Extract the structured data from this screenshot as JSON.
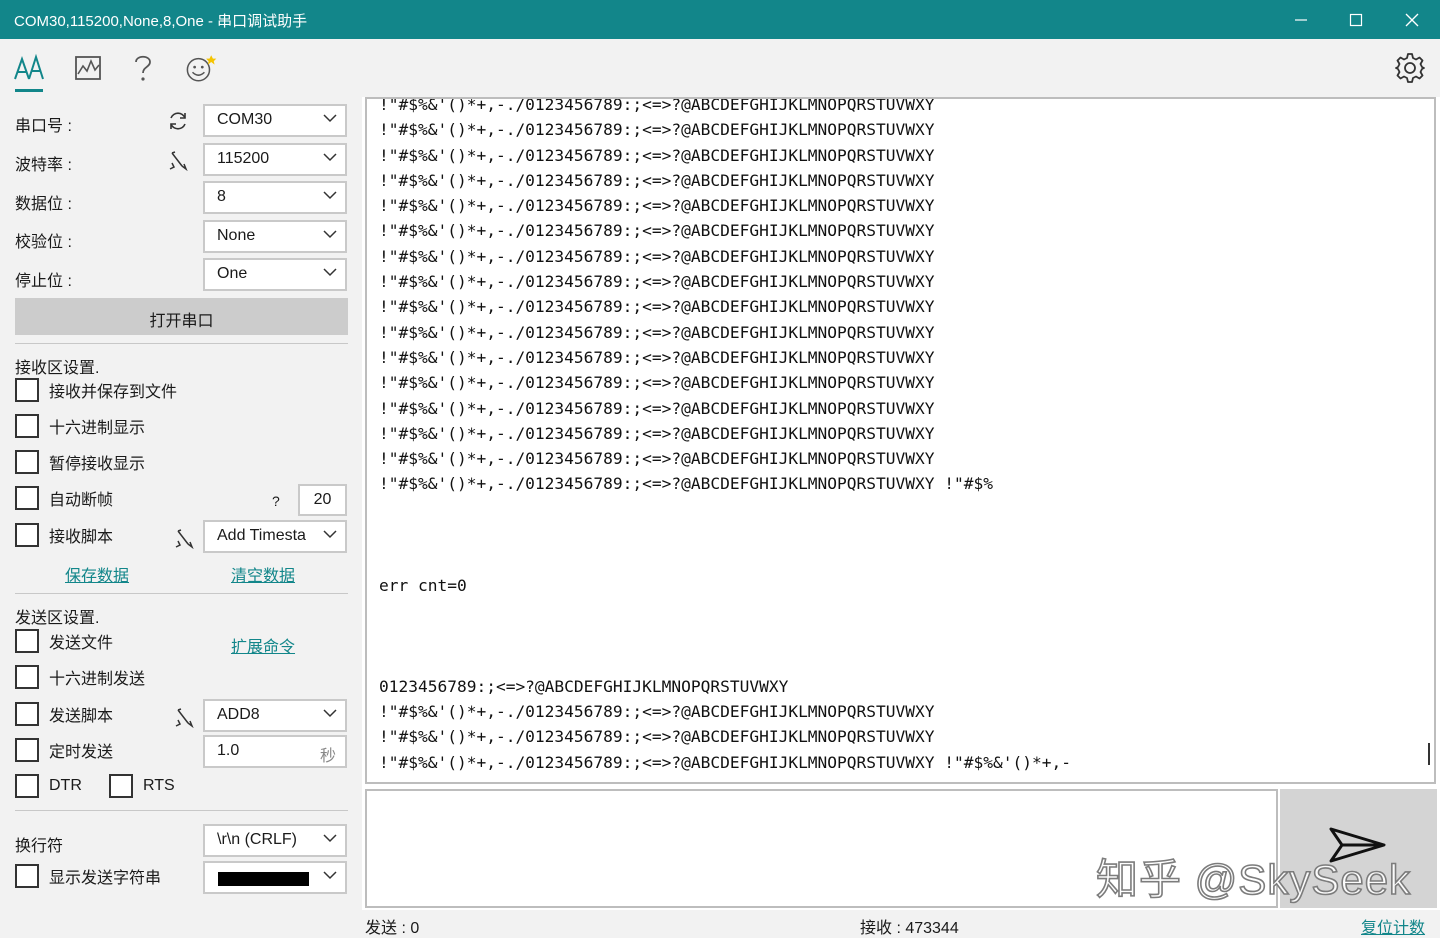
{
  "window": {
    "title": "COM30,115200,None,8,One - 串口调试助手",
    "minimize": "—",
    "maximize": "☐",
    "close": "✕"
  },
  "toolbar": {
    "icons": [
      "text-font-icon",
      "chart-icon",
      "help-icon",
      "smiley-icon"
    ],
    "settings_icon": "gear-icon",
    "accent": "#12868a"
  },
  "serial": {
    "port_label": "串口号 :",
    "port_value": "COM30",
    "baud_label": "波特率 :",
    "baud_value": "115200",
    "databits_label": "数据位 :",
    "databits_value": "8",
    "parity_label": "校验位 :",
    "parity_value": "None",
    "stopbits_label": "停止位 :",
    "stopbits_value": "One",
    "open_button": "打开串口"
  },
  "receive_settings": {
    "title": "接收区设置.",
    "save_to_file": "接收并保存到文件",
    "hex_display": "十六进制显示",
    "pause_display": "暂停接收显示",
    "auto_frame": "自动断帧",
    "auto_frame_help": "?",
    "auto_frame_value": "20",
    "script": "接收脚本",
    "script_value": "Add Timesta",
    "save_data": "保存数据",
    "clear_data": "清空数据"
  },
  "send_settings": {
    "title": "发送区设置.",
    "send_file": "发送文件",
    "extend_cmd": "扩展命令",
    "hex_send": "十六进制发送",
    "script": "发送脚本",
    "script_value": "ADD8",
    "timed_send": "定时发送",
    "timed_value": "1.0",
    "timed_unit": "秒",
    "dtr": "DTR",
    "rts": "RTS",
    "newline_label": "换行符",
    "newline_value": "\\r\\n (CRLF)",
    "show_string": "显示发送字符串"
  },
  "receive_area": {
    "lines": [
      "!\"#$%&'()*+,-./0123456789:;<=>?@ABCDEFGHIJKLMNOPQRSTUVWXY",
      "!\"#$%&'()*+,-./0123456789:;<=>?@ABCDEFGHIJKLMNOPQRSTUVWXY",
      "!\"#$%&'()*+,-./0123456789:;<=>?@ABCDEFGHIJKLMNOPQRSTUVWXY",
      "!\"#$%&'()*+,-./0123456789:;<=>?@ABCDEFGHIJKLMNOPQRSTUVWXY",
      "!\"#$%&'()*+,-./0123456789:;<=>?@ABCDEFGHIJKLMNOPQRSTUVWXY",
      "!\"#$%&'()*+,-./0123456789:;<=>?@ABCDEFGHIJKLMNOPQRSTUVWXY",
      "!\"#$%&'()*+,-./0123456789:;<=>?@ABCDEFGHIJKLMNOPQRSTUVWXY",
      "!\"#$%&'()*+,-./0123456789:;<=>?@ABCDEFGHIJKLMNOPQRSTUVWXY",
      "!\"#$%&'()*+,-./0123456789:;<=>?@ABCDEFGHIJKLMNOPQRSTUVWXY",
      "!\"#$%&'()*+,-./0123456789:;<=>?@ABCDEFGHIJKLMNOPQRSTUVWXY",
      "!\"#$%&'()*+,-./0123456789:;<=>?@ABCDEFGHIJKLMNOPQRSTUVWXY",
      "!\"#$%&'()*+,-./0123456789:;<=>?@ABCDEFGHIJKLMNOPQRSTUVWXY",
      "!\"#$%&'()*+,-./0123456789:;<=>?@ABCDEFGHIJKLMNOPQRSTUVWXY",
      "!\"#$%&'()*+,-./0123456789:;<=>?@ABCDEFGHIJKLMNOPQRSTUVWXY",
      "!\"#$%&'()*+,-./0123456789:;<=>?@ABCDEFGHIJKLMNOPQRSTUVWXY",
      "!\"#$%&'()*+,-./0123456789:;<=>?@ABCDEFGHIJKLMNOPQRSTUVWXY !\"#$%",
      "",
      "",
      "",
      "err cnt=0",
      "",
      "",
      "",
      "0123456789:;<=>?@ABCDEFGHIJKLMNOPQRSTUVWXY",
      "!\"#$%&'()*+,-./0123456789:;<=>?@ABCDEFGHIJKLMNOPQRSTUVWXY",
      "!\"#$%&'()*+,-./0123456789:;<=>?@ABCDEFGHIJKLMNOPQRSTUVWXY",
      "!\"#$%&'()*+,-./0123456789:;<=>?@ABCDEFGHIJKLMNOPQRSTUVWXY !\"#$%&'()*+,-"
    ]
  },
  "send_area": {
    "value": "",
    "send_icon": "send-arrow-icon"
  },
  "watermark": "知乎 @SkySeek",
  "status": {
    "sent": "发送 : 0",
    "received": "接收 : 473344",
    "reset": "复位计数"
  }
}
